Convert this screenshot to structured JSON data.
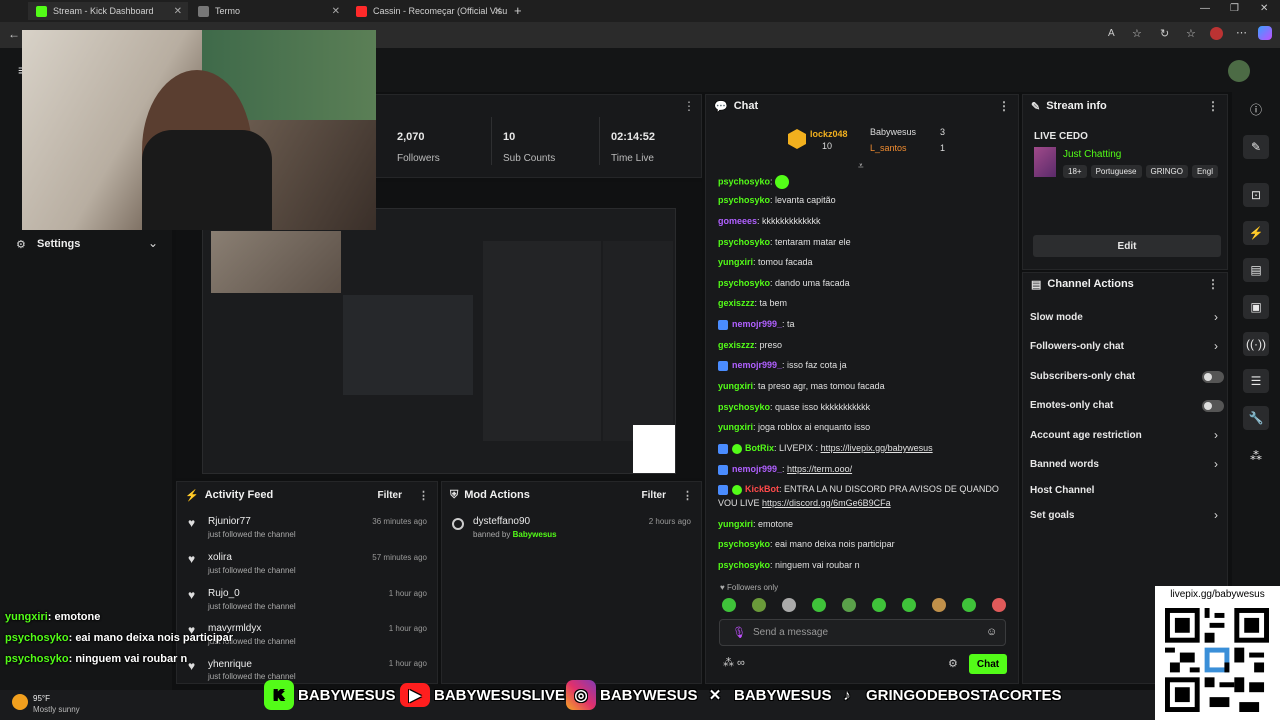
{
  "tabs": [
    {
      "label": "Stream - Kick Dashboard",
      "color": "#53fc18"
    },
    {
      "label": "Termo",
      "color": "#777"
    },
    {
      "label": "Cassin - Recomeçar (Official Visu",
      "color": "#ff2a2a"
    }
  ],
  "stats": [
    {
      "value": "2,070",
      "label": "Followers"
    },
    {
      "value": "10",
      "label": "Sub Counts"
    },
    {
      "value": "02:14:52",
      "label": "Time Live"
    }
  ],
  "sidebar": {
    "settings_label": "Settings"
  },
  "chat": {
    "title": "Chat",
    "top": [
      {
        "name": "lockz048",
        "score": "10"
      },
      {
        "name": "Babywesus",
        "score": "3"
      },
      {
        "name": "L_santos",
        "score": "1"
      }
    ],
    "messages": [
      {
        "user": "psychosyko",
        "text": ""
      },
      {
        "user": "psychosyko",
        "text": "levanta capitão"
      },
      {
        "user": "gomeees",
        "text": "kkkkkkkkkkkkk"
      },
      {
        "user": "psychosyko",
        "text": "tentaram matar ele"
      },
      {
        "user": "yungxiri",
        "text": "tomou facada"
      },
      {
        "user": "psychosyko",
        "text": "dando uma facada"
      },
      {
        "user": "gexiszzz",
        "text": "ta bem"
      },
      {
        "user": "nemojr999_",
        "text": "ta"
      },
      {
        "user": "gexiszzz",
        "text": "preso"
      },
      {
        "user": "nemojr999_",
        "text": "isso faz cota ja"
      },
      {
        "user": "yungxiri",
        "text": "ta preso agr, mas tomou facada"
      },
      {
        "user": "psychosyko",
        "text": "quase isso kkkkkkkkkkk"
      },
      {
        "user": "yungxiri",
        "text": "joga roblox ai enquanto isso"
      },
      {
        "user": "BotRix",
        "text": "LIVEPIX :",
        "link": "https://livepix.gg/babywesus"
      },
      {
        "user": "nemojr999_",
        "text": "",
        "link": "https://term.ooo/"
      },
      {
        "user": "KickBot",
        "text": "ENTRA LA NU DISCORD PRA AVISOS DE QUANDO",
        "text2": "VOU LIVE",
        "link": "https://discord.gg/6mGe6B9CFa"
      },
      {
        "user": "yungxiri",
        "text": "emotone"
      },
      {
        "user": "psychosyko",
        "text": "eai mano deixa nois participar"
      },
      {
        "user": "psychosyko",
        "text": "ninguem vai roubar n"
      }
    ],
    "followers_only": "Followers only",
    "placeholder": "Send a message",
    "send": "Chat"
  },
  "stream_info": {
    "title": "Stream info",
    "live_title": "LIVE CEDO",
    "category": "Just Chatting",
    "tags": [
      "18+",
      "Portuguese",
      "GRINGO",
      "Engl"
    ],
    "edit": "Edit"
  },
  "channel_actions": {
    "title": "Channel Actions",
    "items": [
      "Slow mode",
      "Followers-only chat",
      "Subscribers-only chat",
      "Emotes-only chat",
      "Account age restriction",
      "Banned words",
      "Host Channel",
      "Set goals"
    ]
  },
  "activity": {
    "title": "Activity Feed",
    "filter": "Filter",
    "items": [
      {
        "name": "Rjunior77",
        "sub": "just followed the channel",
        "time": "36 minutes ago"
      },
      {
        "name": "xolira",
        "sub": "just followed the channel",
        "time": "57 minutes ago"
      },
      {
        "name": "Rujo_0",
        "sub": "just followed the channel",
        "time": "1 hour ago"
      },
      {
        "name": "mavyrmldyx",
        "sub": "just followed the channel",
        "time": "1 hour ago"
      },
      {
        "name": "yhenrique",
        "sub": "just followed the channel",
        "time": "1 hour ago"
      }
    ]
  },
  "mod": {
    "title": "Mod Actions",
    "filter": "Filter",
    "user": "dysteffano90",
    "by_prefix": "banned by",
    "by": "Babywesus",
    "time": "2 hours ago"
  },
  "overlay": {
    "chat": [
      {
        "user": "yungxiri",
        "text": ": emotone"
      },
      {
        "user": "psychosyko",
        "text": ": eai mano deixa nois participar"
      },
      {
        "user": "psychosyko",
        "text": ": ninguem vai roubar n"
      }
    ],
    "socials": [
      "BABYWESUS",
      "BABYWESUSLIVE",
      "BABYWESUS",
      "BABYWESUS",
      "GRINGODEBOSTACORTES"
    ],
    "qr_label": "livepix.gg/babywesus"
  },
  "taskbar": {
    "temp": "95°F",
    "weather": "Mostly sunny"
  }
}
